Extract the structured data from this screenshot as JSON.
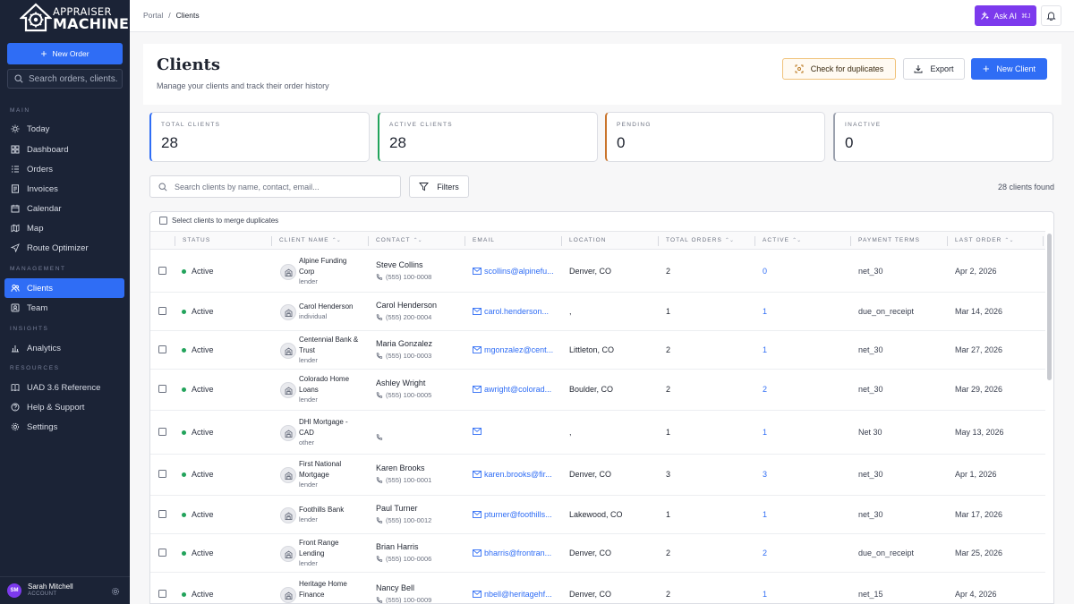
{
  "brand": {
    "line1": "APPRAISER",
    "line2": "MACHINE"
  },
  "sidebar": {
    "new_order_label": "New Order",
    "search_placeholder": "Search orders, clients...",
    "sections": {
      "main": "MAIN",
      "management": "MANAGEMENT",
      "insights": "INSIGHTS",
      "resources": "RESOURCES"
    },
    "items": [
      {
        "label": "Today",
        "icon": "sun-icon"
      },
      {
        "label": "Dashboard",
        "icon": "grid-icon"
      },
      {
        "label": "Orders",
        "icon": "list-icon"
      },
      {
        "label": "Invoices",
        "icon": "invoice-icon"
      },
      {
        "label": "Calendar",
        "icon": "calendar-icon"
      },
      {
        "label": "Map",
        "icon": "map-icon"
      },
      {
        "label": "Route Optimizer",
        "icon": "navigation-icon"
      },
      {
        "label": "Clients",
        "icon": "users-icon"
      },
      {
        "label": "Team",
        "icon": "team-icon"
      },
      {
        "label": "Analytics",
        "icon": "bar-chart-icon"
      },
      {
        "label": "UAD 3.6 Reference",
        "icon": "book-icon"
      },
      {
        "label": "Help & Support",
        "icon": "help-icon"
      },
      {
        "label": "Settings",
        "icon": "gear-icon"
      }
    ],
    "user": {
      "initials": "SM",
      "name": "Sarah Mitchell",
      "role": "ACCOUNT"
    }
  },
  "topbar": {
    "breadcrumb": [
      "Portal",
      "/",
      "Clients"
    ],
    "ask_ai_label": "Ask AI",
    "ask_ai_shortcut": "⌘J"
  },
  "header": {
    "title": "Clients",
    "subtitle": "Manage your clients and track their order history",
    "check_duplicates_label": "Check for duplicates",
    "export_label": "Export",
    "new_client_label": "New Client"
  },
  "stats": [
    {
      "label": "TOTAL CLIENTS",
      "value": "28",
      "color": "#2f6df5"
    },
    {
      "label": "ACTIVE CLIENTS",
      "value": "28",
      "color": "#22a35b"
    },
    {
      "label": "PENDING",
      "value": "0",
      "color": "#c9742b"
    },
    {
      "label": "INACTIVE",
      "value": "0",
      "color": "#9aa0ad"
    }
  ],
  "search": {
    "placeholder": "Search clients by name, contact, email...",
    "filters_label": "Filters",
    "found_text": "28 clients found"
  },
  "table": {
    "merge_label": "Select clients to merge duplicates",
    "columns": [
      "STATUS",
      "CLIENT NAME",
      "CONTACT",
      "EMAIL",
      "LOCATION",
      "TOTAL ORDERS",
      "ACTIVE",
      "PAYMENT TERMS",
      "LAST ORDER"
    ],
    "sort_glyph": "⌃⌄",
    "rows": [
      {
        "status": "Active",
        "name_l1": "Alpine Funding",
        "name_l2": "Corp",
        "type": "lender",
        "contact": "Steve Collins",
        "phone": "(555) 100-0008",
        "email": "scollins@alpinefu...",
        "location": "Denver, CO",
        "orders": "2",
        "active": "0",
        "terms": "net_30",
        "last_order": "Apr 2, 2026"
      },
      {
        "status": "Active",
        "name_l1": "Carol Henderson",
        "name_l2": "",
        "type": "individual",
        "contact": "Carol Henderson",
        "phone": "(555) 200-0004",
        "email": "carol.henderson...",
        "location": ",",
        "orders": "1",
        "active": "1",
        "terms": "due_on_receipt",
        "last_order": "Mar 14, 2026"
      },
      {
        "status": "Active",
        "name_l1": "Centennial Bank &",
        "name_l2": "Trust",
        "type": "lender",
        "contact": "Maria Gonzalez",
        "phone": "(555) 100-0003",
        "email": "mgonzalez@cent...",
        "location": "Littleton, CO",
        "orders": "2",
        "active": "1",
        "terms": "net_30",
        "last_order": "Mar 27, 2026"
      },
      {
        "status": "Active",
        "name_l1": "Colorado Home",
        "name_l2": "Loans",
        "type": "lender",
        "contact": "Ashley Wright",
        "phone": "(555) 100-0005",
        "email": "awright@colorad...",
        "location": "Boulder, CO",
        "orders": "2",
        "active": "2",
        "terms": "net_30",
        "last_order": "Mar 29, 2026"
      },
      {
        "status": "Active",
        "name_l1": "DHI Mortgage -",
        "name_l2": "CAD",
        "type": "other",
        "contact": "",
        "phone": "",
        "email": "",
        "location": ",",
        "orders": "1",
        "active": "1",
        "terms": "Net 30",
        "last_order": "May 13, 2026"
      },
      {
        "status": "Active",
        "name_l1": "First National",
        "name_l2": "Mortgage",
        "type": "lender",
        "contact": "Karen Brooks",
        "phone": "(555) 100-0001",
        "email": "karen.brooks@fir...",
        "location": "Denver, CO",
        "orders": "3",
        "active": "3",
        "terms": "net_30",
        "last_order": "Apr 1, 2026"
      },
      {
        "status": "Active",
        "name_l1": "Foothills Bank",
        "name_l2": "",
        "type": "lender",
        "contact": "Paul Turner",
        "phone": "(555) 100-0012",
        "email": "pturner@foothills...",
        "location": "Lakewood, CO",
        "orders": "1",
        "active": "1",
        "terms": "net_30",
        "last_order": "Mar 17, 2026"
      },
      {
        "status": "Active",
        "name_l1": "Front Range",
        "name_l2": "Lending",
        "type": "lender",
        "contact": "Brian Harris",
        "phone": "(555) 100-0006",
        "email": "bharris@frontran...",
        "location": "Denver, CO",
        "orders": "2",
        "active": "2",
        "terms": "due_on_receipt",
        "last_order": "Mar 25, 2026"
      },
      {
        "status": "Active",
        "name_l1": "Heritage Home",
        "name_l2": "Finance",
        "type": "",
        "contact": "Nancy Bell",
        "phone": "(555) 100-0009",
        "email": "nbell@heritagehf...",
        "location": "Denver, CO",
        "orders": "2",
        "active": "1",
        "terms": "net_15",
        "last_order": "Apr 4, 2026"
      }
    ]
  },
  "colors": {
    "primary": "#2f6df5",
    "ai": "#7c3aed",
    "sidebar": "#1b2336",
    "active_dot": "#22a35b"
  }
}
